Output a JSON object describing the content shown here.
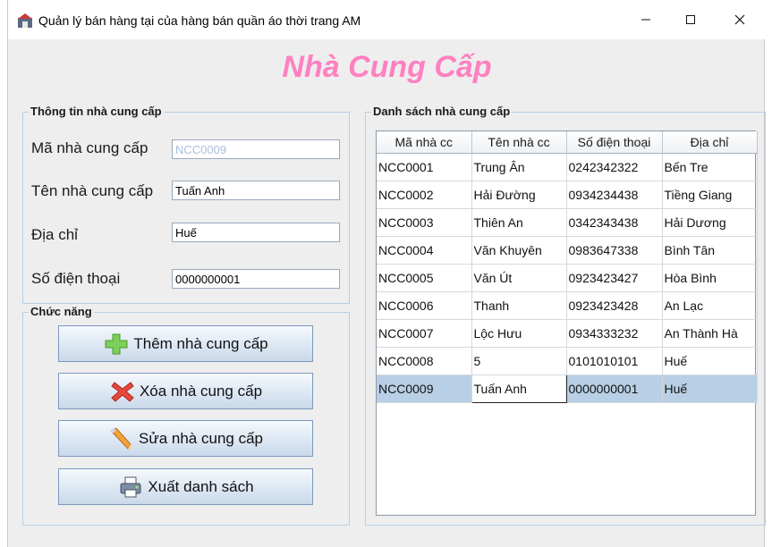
{
  "window": {
    "title": "Quản lý bán hàng tại của hàng bán quần áo thời trang AM",
    "controls": {
      "minimize": "—",
      "maximize": "☐",
      "close": "✕"
    }
  },
  "header": {
    "title": "Nhà Cung Cấp"
  },
  "info_panel": {
    "legend": "Thông tin nhà cung cấp",
    "fields": [
      {
        "label": "Mã nhà cung cấp",
        "value": "NCC0009",
        "disabled": true
      },
      {
        "label": "Tên nhà cung cấp",
        "value": "Tuấn Anh"
      },
      {
        "label": "Địa chỉ",
        "value": "Huế"
      },
      {
        "label": "Số điện thoại",
        "value": "0000000001"
      }
    ]
  },
  "function_panel": {
    "legend": "Chức năng",
    "buttons": [
      {
        "label": "Thêm nhà cung cấp",
        "icon": "plus-icon"
      },
      {
        "label": "Xóa nhà cung cấp",
        "icon": "delete-x-icon"
      },
      {
        "label": "Sửa nhà cung cấp",
        "icon": "pencil-edit-icon"
      },
      {
        "label": "Xuất danh sách",
        "icon": "printer-icon"
      }
    ]
  },
  "list_panel": {
    "legend": "Danh sách nhà cung cấp",
    "columns": [
      "Mã nhà cc",
      "Tên nhà cc",
      "Số điện thoại",
      "Địa chỉ"
    ],
    "rows": [
      [
        "NCC0001",
        "Trung Ân",
        "0242342322",
        "Bến Tre"
      ],
      [
        "NCC0002",
        "Hải Đường",
        "0934234438",
        "Tiềng Giang"
      ],
      [
        "NCC0003",
        "Thiên An",
        "0342343438",
        "Hải Dương"
      ],
      [
        "NCC0004",
        "Văn Khuyên",
        "0983647338",
        "Bình Tân"
      ],
      [
        "NCC0005",
        "Văn Út",
        "0923423427",
        "Hòa Bình"
      ],
      [
        "NCC0006",
        "Thanh",
        "0923423428",
        "An Lạc"
      ],
      [
        "NCC0007",
        "Lộc Hưu",
        "0934333232",
        "An Thành Hà"
      ],
      [
        "NCC0008",
        "5",
        "0101010101",
        "Huế"
      ],
      [
        "NCC0009",
        "Tuấn Anh",
        "0000000001",
        "Huế"
      ]
    ],
    "selected_row": 8
  },
  "colors": {
    "title_pink": "#ff80c0",
    "selection": "#b8cfe5",
    "group_border": "#b8cfe5"
  }
}
